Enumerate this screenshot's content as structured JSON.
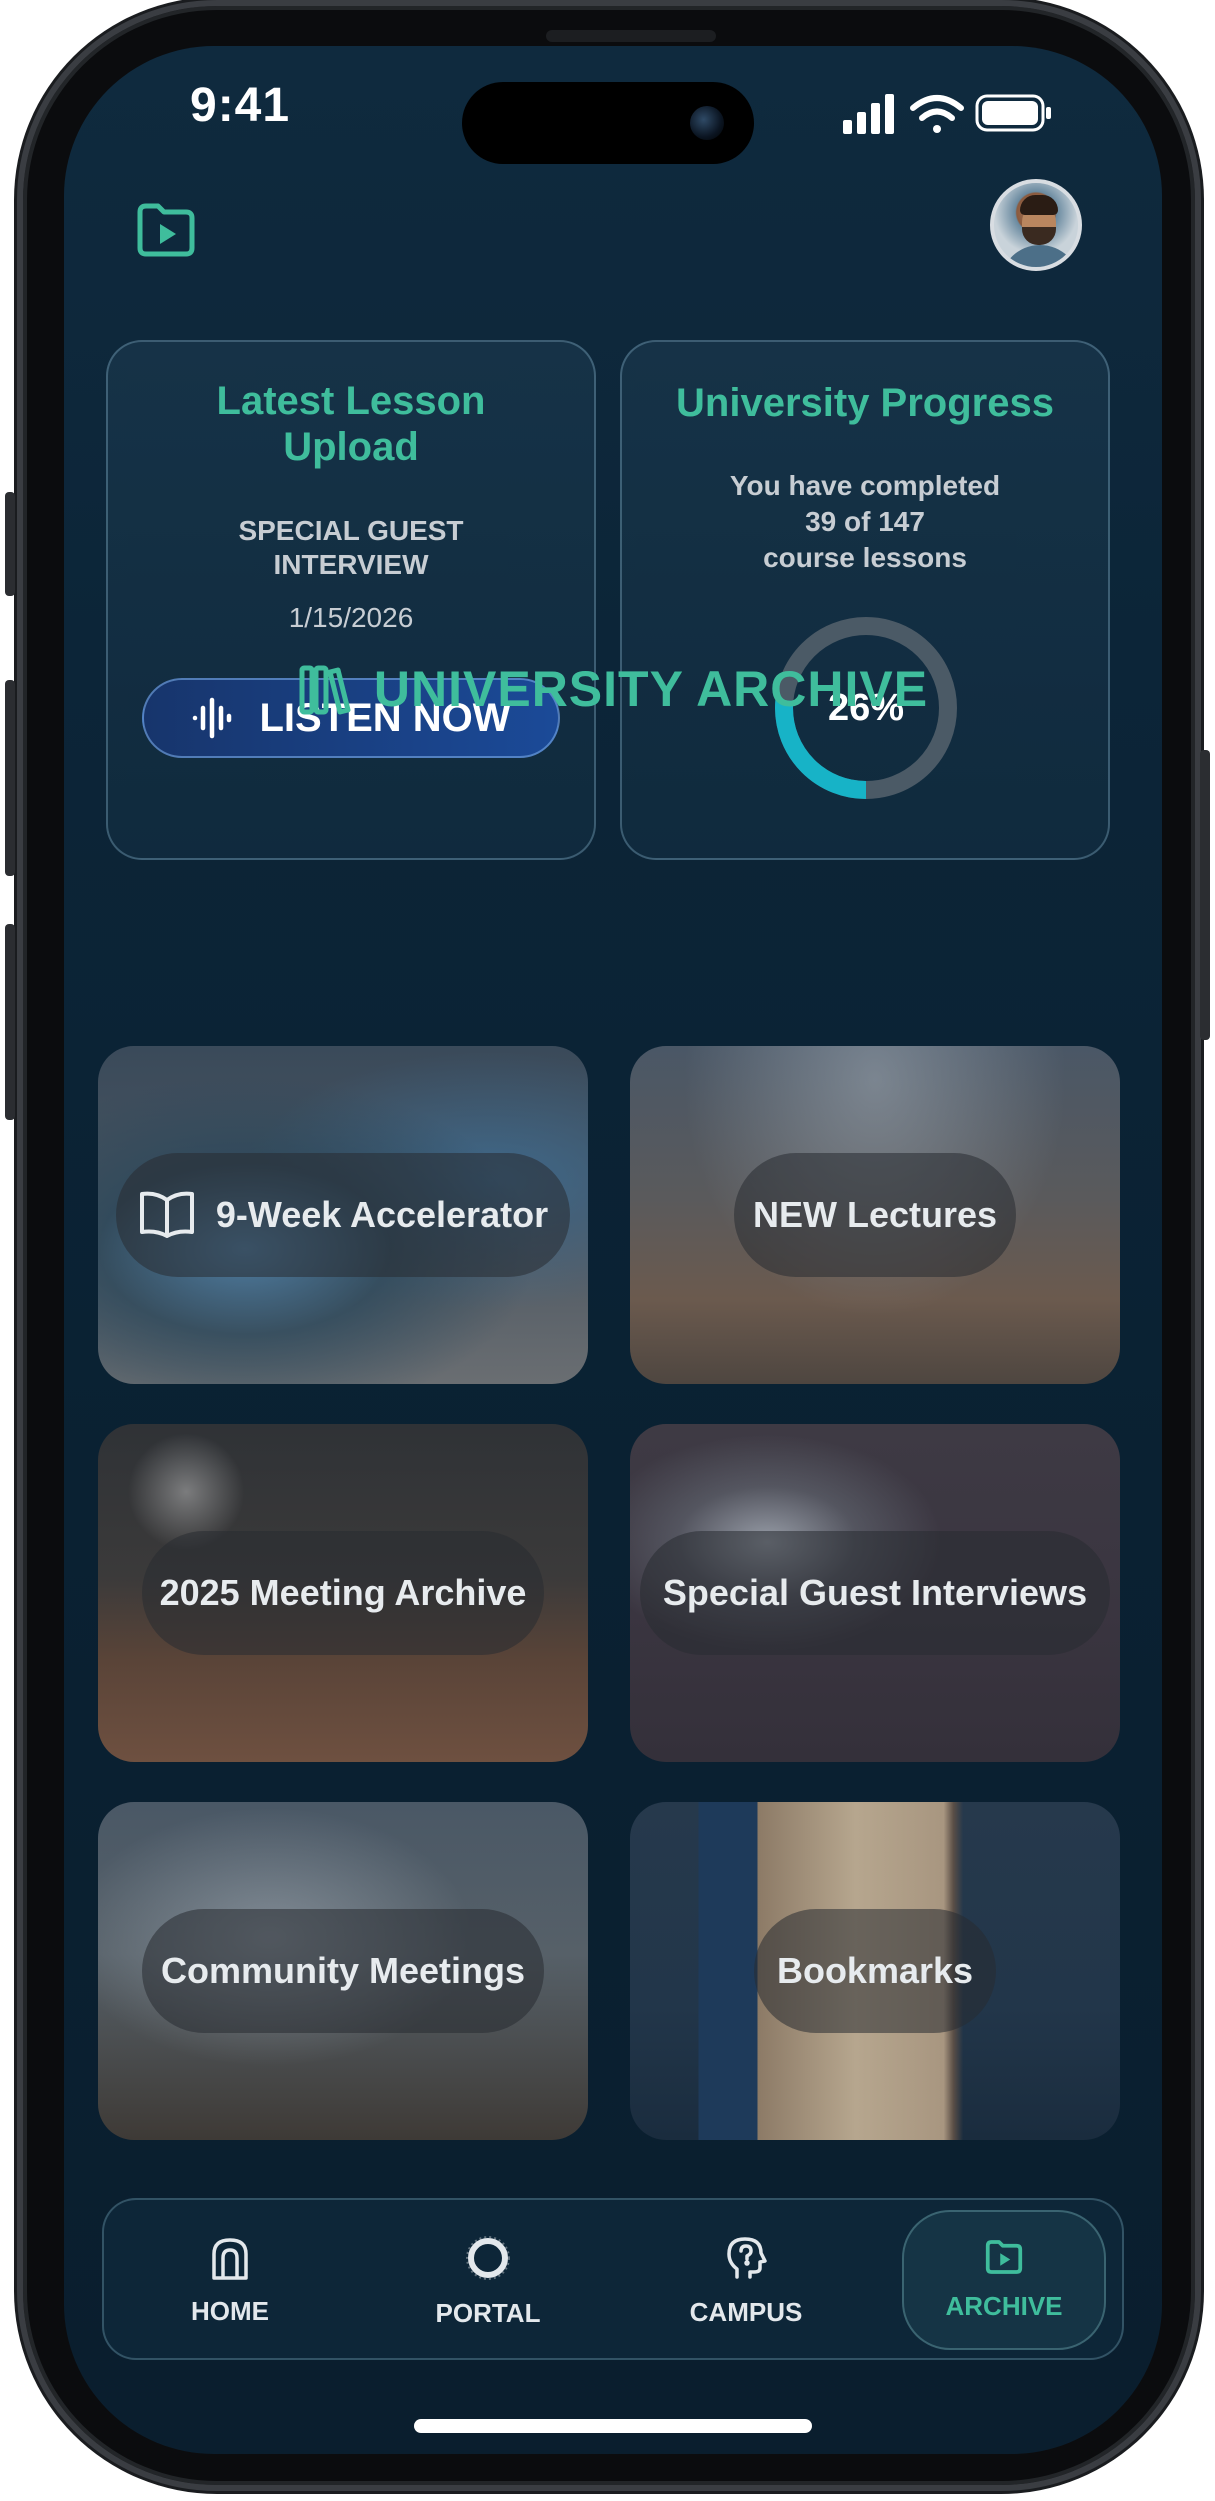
{
  "status_bar": {
    "time": "9:41"
  },
  "header": {
    "left_icon": "folder-play-icon",
    "avatar": "user-avatar"
  },
  "latest_lesson": {
    "title": "Latest Lesson Upload",
    "subtitle": "SPECIAL GUEST INTERVIEW",
    "date": "1/15/2026",
    "button_label": "LISTEN NOW",
    "button_icon": "audio-wave-icon"
  },
  "progress": {
    "title": "University Progress",
    "line1": "You have completed",
    "line2": "39 of 147",
    "line3": "course lessons",
    "percent_label": "26%",
    "completed": 39,
    "total": 147,
    "fraction": 0.2653
  },
  "archive": {
    "heading": "UNIVERSITY ARCHIVE",
    "heading_icon": "library-icon",
    "tiles": [
      {
        "label": "9-Week Accelerator",
        "icon": "open-book-icon"
      },
      {
        "label": "NEW Lectures"
      },
      {
        "label": "2025 Meeting Archive"
      },
      {
        "label": "Special Guest Interviews"
      },
      {
        "label": "Community Meetings"
      },
      {
        "label": "Bookmarks"
      }
    ]
  },
  "nav": {
    "items": [
      {
        "label": "HOME",
        "icon": "home-arch-icon"
      },
      {
        "label": "PORTAL",
        "icon": "portal-ring-icon"
      },
      {
        "label": "CAMPUS",
        "icon": "head-idea-icon"
      },
      {
        "label": "ARCHIVE",
        "icon": "folder-play-icon",
        "active": true
      }
    ]
  },
  "colors": {
    "accent": "#3fbd9c",
    "background": "#0c2538",
    "button": "#1b4a98",
    "ring_fill": "#17b3c7",
    "ring_track": "#4b5a66"
  }
}
